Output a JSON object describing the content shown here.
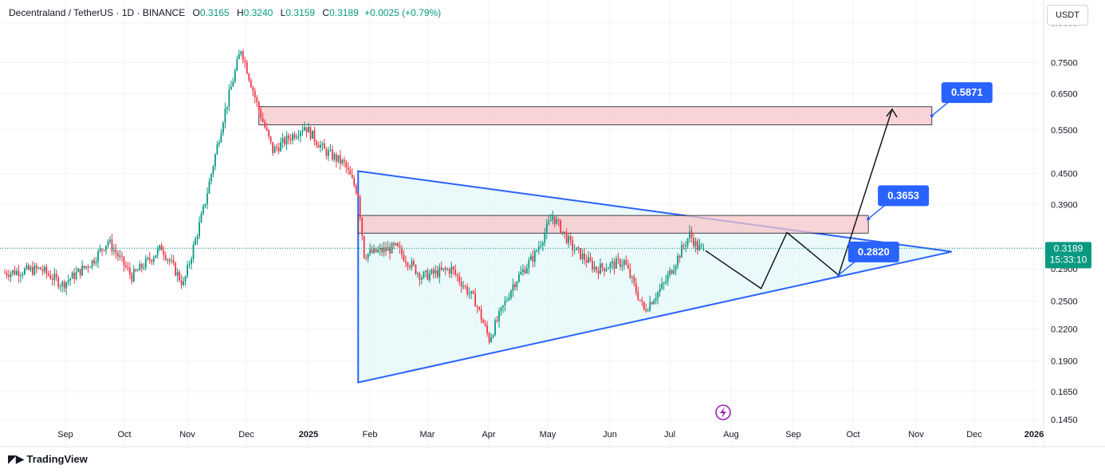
{
  "header": {
    "symbol": "Decentraland / TetherUS · 1D · BINANCE",
    "o_label": "O",
    "o": "0.3165",
    "h_label": "H",
    "h": "0.3240",
    "l_label": "L",
    "l": "0.3159",
    "c_label": "C",
    "c": "0.3189",
    "change": "+0.0025 (+0.79%)"
  },
  "currency_button": "USDT",
  "brand": "TradingView",
  "colors": {
    "up": "#089981",
    "down": "#f23645",
    "accent": "#2962ff",
    "zone_fill": "#f7c6c8",
    "triangle_fill": "#e5f7f7"
  },
  "last_price": {
    "value": "0.3189",
    "countdown": "15:33:10"
  },
  "callouts": [
    {
      "label": "0.5871",
      "price": 0.5871,
      "date": "2025-11-17"
    },
    {
      "label": "0.3653",
      "price": 0.3653,
      "date": "2025-10-16"
    },
    {
      "label": "0.2820",
      "price": 0.282,
      "date": "2025-10-01"
    }
  ],
  "chart_data": {
    "type": "candlestick",
    "y_scale": "log",
    "y_ticks": [
      "0.9000",
      "0.7500",
      "0.6500",
      "0.5500",
      "0.4500",
      "0.3900",
      "0.3200",
      "0.2900",
      "0.2500",
      "0.2200",
      "0.1900",
      "0.1650",
      "0.1450"
    ],
    "x_ticks": [
      "Sep",
      "Oct",
      "Nov",
      "Dec",
      "2025",
      "Feb",
      "Mar",
      "Apr",
      "May",
      "Jun",
      "Jul",
      "Aug",
      "Sep",
      "Oct",
      "Nov",
      "Dec",
      "2026"
    ],
    "x_range": [
      "2024-08-07",
      "2026-01-08"
    ],
    "y_range": [
      0.128,
      1.0
    ],
    "price_path": [
      {
        "date": "2024-08-07",
        "close": 0.285
      },
      {
        "date": "2024-08-25",
        "close": 0.29
      },
      {
        "date": "2024-09-05",
        "close": 0.27
      },
      {
        "date": "2024-09-20",
        "close": 0.3
      },
      {
        "date": "2024-09-28",
        "close": 0.33
      },
      {
        "date": "2024-10-10",
        "close": 0.28
      },
      {
        "date": "2024-10-25",
        "close": 0.32
      },
      {
        "date": "2024-11-05",
        "close": 0.27
      },
      {
        "date": "2024-11-15",
        "close": 0.38
      },
      {
        "date": "2024-11-25",
        "close": 0.58
      },
      {
        "date": "2024-12-04",
        "close": 0.8
      },
      {
        "date": "2024-12-12",
        "close": 0.62
      },
      {
        "date": "2024-12-20",
        "close": 0.5
      },
      {
        "date": "2025-01-05",
        "close": 0.56
      },
      {
        "date": "2025-01-15",
        "close": 0.5
      },
      {
        "date": "2025-01-25",
        "close": 0.47
      },
      {
        "date": "2025-02-01",
        "close": 0.41
      },
      {
        "date": "2025-02-04",
        "close": 0.31
      },
      {
        "date": "2025-02-20",
        "close": 0.32
      },
      {
        "date": "2025-03-05",
        "close": 0.28
      },
      {
        "date": "2025-03-20",
        "close": 0.29
      },
      {
        "date": "2025-04-01",
        "close": 0.25
      },
      {
        "date": "2025-04-08",
        "close": 0.21
      },
      {
        "date": "2025-04-20",
        "close": 0.27
      },
      {
        "date": "2025-05-01",
        "close": 0.31
      },
      {
        "date": "2025-05-10",
        "close": 0.37
      },
      {
        "date": "2025-05-20",
        "close": 0.32
      },
      {
        "date": "2025-06-01",
        "close": 0.29
      },
      {
        "date": "2025-06-15",
        "close": 0.3
      },
      {
        "date": "2025-06-25",
        "close": 0.24
      },
      {
        "date": "2025-07-05",
        "close": 0.27
      },
      {
        "date": "2025-07-18",
        "close": 0.34
      },
      {
        "date": "2025-07-22",
        "close": 0.32
      },
      {
        "date": "2025-07-25",
        "close": 0.3189
      }
    ],
    "zones": [
      {
        "from_date": "2024-12-13",
        "to_date": "2025-11-17",
        "low": 0.563,
        "high": 0.612
      },
      {
        "from_date": "2025-02-01",
        "to_date": "2025-10-16",
        "low": 0.342,
        "high": 0.371
      }
    ],
    "triangle": [
      {
        "date": "2025-02-01",
        "price": 0.455
      },
      {
        "date": "2025-02-01",
        "price": 0.172
      },
      {
        "date": "2025-11-27",
        "price": 0.314
      }
    ],
    "projection_path": [
      {
        "date": "2025-07-26",
        "price": 0.3155
      },
      {
        "date": "2025-08-23",
        "price": 0.265
      },
      {
        "date": "2025-09-05",
        "price": 0.343
      },
      {
        "date": "2025-10-01",
        "price": 0.282
      },
      {
        "date": "2025-10-28",
        "price": 0.605
      }
    ]
  }
}
